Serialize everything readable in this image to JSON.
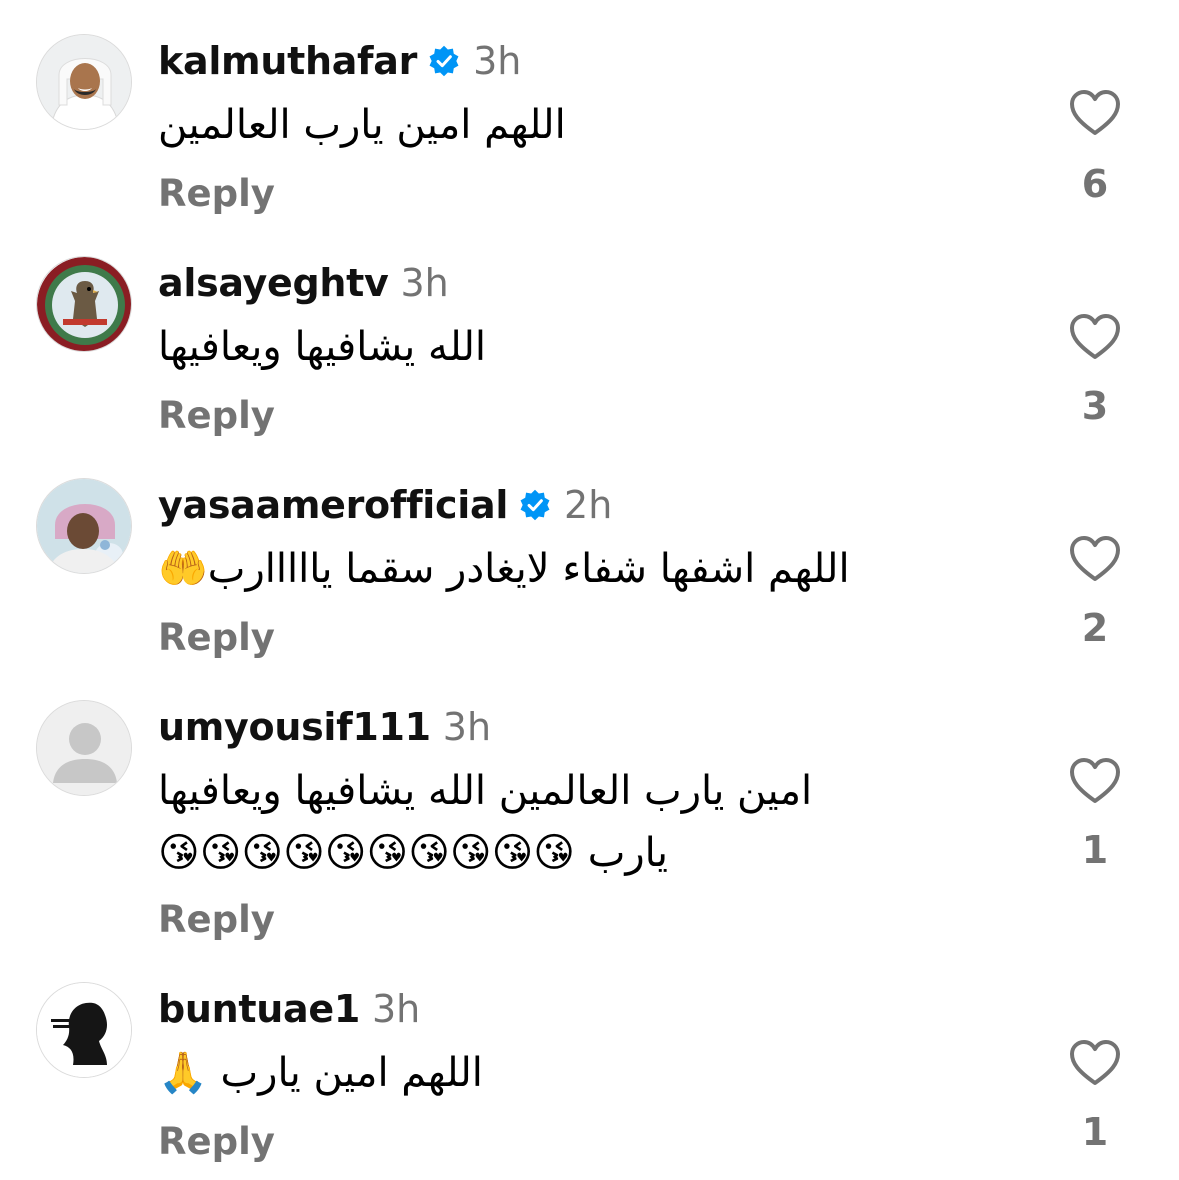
{
  "reply_label": "Reply",
  "comments": [
    {
      "username": "kalmuthafar",
      "verified": true,
      "time": "3h",
      "lines": [
        "اللهم امين يارب العالمين"
      ],
      "likes": "6",
      "avatar_icon": "person-photo-avatar"
    },
    {
      "username": "alsayeghtv",
      "verified": false,
      "time": "3h",
      "lines": [
        "الله يشافيها ويعافيها"
      ],
      "likes": "3",
      "avatar_icon": "falcon-logo-avatar"
    },
    {
      "username": "yasaamerofficial",
      "verified": true,
      "time": "2h",
      "lines": [
        "اللهم اشفها شفاء لايغادر سقما يااااارب🤲"
      ],
      "likes": "2",
      "avatar_icon": "person-photo-avatar"
    },
    {
      "username": "umyousif111",
      "verified": false,
      "time": "3h",
      "lines": [
        "امين يارب العالمين الله يشافيها ويعافيها",
        "يارب 😘😘😘😘😘😘😘😘😘😘"
      ],
      "likes": "1",
      "avatar_icon": "default-user-avatar"
    },
    {
      "username": "buntuae1",
      "verified": false,
      "time": "3h",
      "lines": [
        "اللهم امين يارب 🙏"
      ],
      "likes": "1",
      "avatar_icon": "silhouette-avatar"
    }
  ],
  "colors": {
    "verified_blue": "#0095f6",
    "muted_text": "#737373"
  }
}
